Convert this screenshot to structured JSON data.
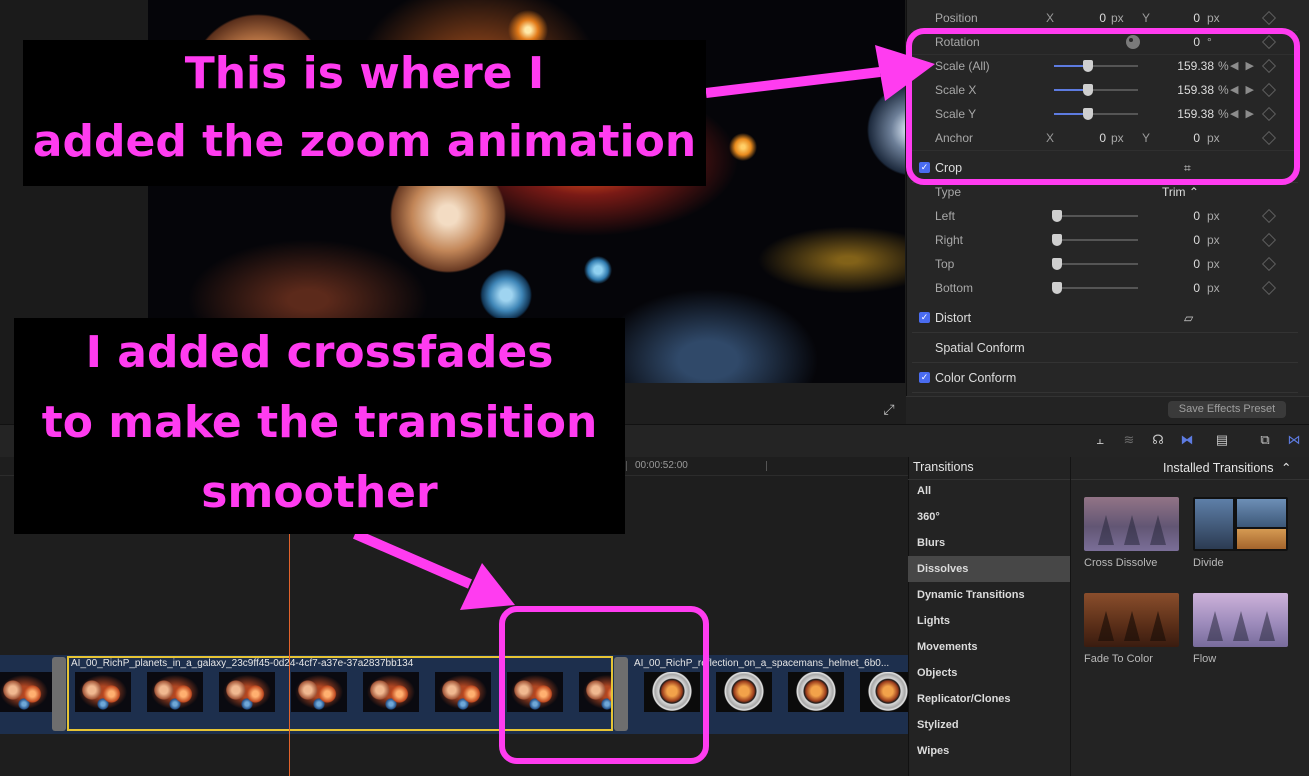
{
  "inspector": {
    "position": {
      "label": "Position",
      "x_axis": "X",
      "x_value": "0",
      "x_unit": "px",
      "y_axis": "Y",
      "y_value": "0",
      "y_unit": "px"
    },
    "rotation": {
      "label": "Rotation",
      "value": "0",
      "unit": "°"
    },
    "scale_all": {
      "label": "Scale (All)",
      "value": "159.38",
      "unit": "%"
    },
    "scale_x": {
      "label": "Scale X",
      "value": "159.38",
      "unit": "%"
    },
    "scale_y": {
      "label": "Scale Y",
      "value": "159.38",
      "unit": "%"
    },
    "anchor": {
      "label": "Anchor",
      "x_axis": "X",
      "x_value": "0",
      "x_unit": "px",
      "y_axis": "Y",
      "y_value": "0",
      "y_unit": "px"
    },
    "crop": {
      "label": "Crop",
      "checked": true
    },
    "crop_type": {
      "label": "Type",
      "value": "Trim ⌃"
    },
    "left": {
      "label": "Left",
      "value": "0",
      "unit": "px"
    },
    "right": {
      "label": "Right",
      "value": "0",
      "unit": "px"
    },
    "top": {
      "label": "Top",
      "value": "0",
      "unit": "px"
    },
    "bottom": {
      "label": "Bottom",
      "value": "0",
      "unit": "px"
    },
    "distort": {
      "label": "Distort",
      "checked": true
    },
    "spatial_conform": {
      "label": "Spatial Conform"
    },
    "color_conform": {
      "label": "Color Conform",
      "checked": true
    },
    "save_preset": "Save Effects Preset",
    "accent_color": "#5d7be0"
  },
  "timeline": {
    "ruler_time": "00:00:52:00",
    "clip1_title": "AI_00_RichP_planets_in_a_galaxy_23c9ff45-0d24-4cf7-a37e-37a2837bb134",
    "clip2_title": "AI_00_RichP_reflection_on_a_spacemans_helmet_6b0...",
    "selection_color": "#e6c435",
    "playhead_color": "#e2632b"
  },
  "transitions": {
    "header": "Transitions",
    "filter": "Installed Transitions",
    "categories": [
      "All",
      "360°",
      "Blurs",
      "Dissolves",
      "Dynamic Transitions",
      "Lights",
      "Movements",
      "Objects",
      "Replicator/Clones",
      "Stylized",
      "Wipes"
    ],
    "selected_category": "Dissolves",
    "items": [
      "Cross Dissolve",
      "Divide",
      "Fade To Color",
      "Flow"
    ]
  },
  "annotations": {
    "top": [
      "This is where I",
      "added the zoom animation"
    ],
    "bottom": [
      "I added crossfades",
      "to make the transition",
      "smoother"
    ],
    "color": "#ff3cf0"
  }
}
